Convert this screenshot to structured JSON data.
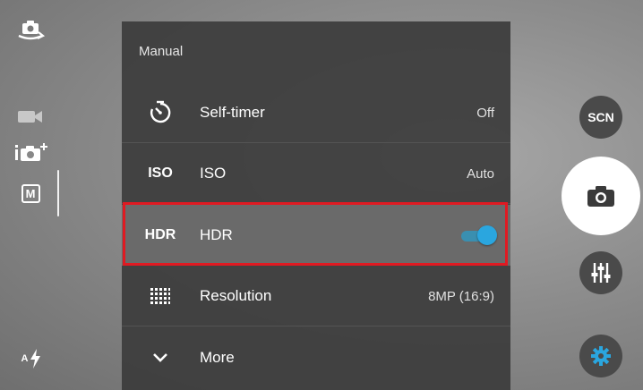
{
  "left_rail": {
    "switch_camera_icon": "switch-camera-icon",
    "video_icon": "video-mode-icon",
    "camera_plus_icon": "camera-plus-icon",
    "manual_mode_label": "M",
    "flash_label": "A"
  },
  "panel": {
    "header": "Manual",
    "rows": [
      {
        "icon": "timer-icon",
        "label": "Self-timer",
        "value": "Off"
      },
      {
        "icon_text": "ISO",
        "label": "ISO",
        "value": "Auto"
      },
      {
        "icon_text": "HDR",
        "label": "HDR",
        "toggle_on": true
      },
      {
        "icon": "grid-icon",
        "label": "Resolution",
        "value": "8MP (16:9)"
      },
      {
        "icon": "chevron-down-icon",
        "label": "More"
      }
    ]
  },
  "right_rail": {
    "scene_label": "SCN",
    "shutter_icon": "camera-icon",
    "adjust_icon": "sliders-icon",
    "settings_icon": "gear-icon"
  },
  "colors": {
    "panel_bg": "#3c3c3c",
    "highlight_border": "#e01a22",
    "toggle_accent": "#2aa6df",
    "gear_accent": "#2aa6df"
  }
}
